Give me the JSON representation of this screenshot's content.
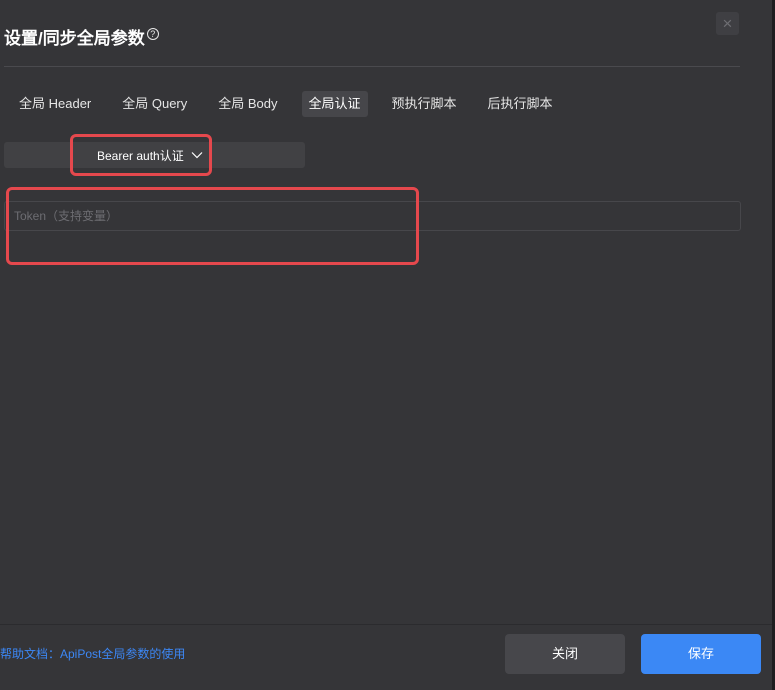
{
  "dialog": {
    "title": "设置/同步全局参数",
    "help_icon": "question-circle-icon",
    "close_glyph": "×"
  },
  "tabs": [
    {
      "label": "全局 Header",
      "active": false
    },
    {
      "label": "全局 Query",
      "active": false
    },
    {
      "label": "全局 Body",
      "active": false
    },
    {
      "label": "全局认证",
      "active": true
    },
    {
      "label": "预执行脚本",
      "active": false
    },
    {
      "label": "后执行脚本",
      "active": false
    }
  ],
  "auth": {
    "selected_type": "Bearer auth认证",
    "token_placeholder": "Token（支持变量）",
    "token_value": ""
  },
  "footer": {
    "help_link": "帮助文档：ApiPost全局参数的使用",
    "close_label": "关闭",
    "save_label": "保存"
  },
  "colors": {
    "highlight": "#e5484d",
    "primary": "#3b88f5",
    "link": "#3c87f5"
  }
}
